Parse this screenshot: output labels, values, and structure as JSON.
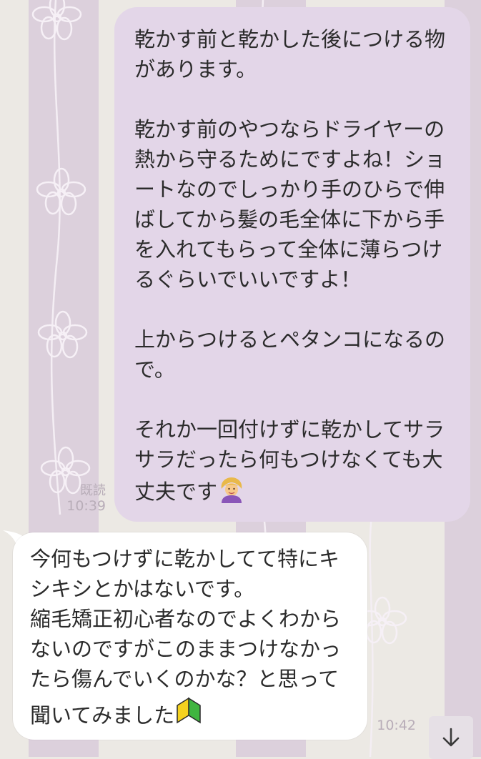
{
  "chat": {
    "outgoing": {
      "text_p1": "乾かす前と乾かした後につける物があります。\n\n乾かす前のやつならドライヤーの熱から守るためにですよね！ショートなのでしっかり手のひらで伸ばしてから髪の毛全体に下から手を入れてもらって全体に薄らつけるぐらいでいいですよ！\n\n上からつけるとペタンコになるので。\n\nそれか一回付けずに乾かしてサラサラだったら何もつけなくても大丈夫です",
      "emoji_icon": "woman-gesturing-ok-icon",
      "read_receipt": "既読",
      "time": "10:39"
    },
    "incoming": {
      "text_p1": "今何もつけずに乾かしてて特にキシキシとかはないです。\n縮毛矯正初心者なのでよくわからないのですがこのままつけなかったら傷んでいくのかな？と思って聞いてみました",
      "emoji_icon": "beginner-mark-icon",
      "time": "10:42"
    }
  },
  "colors": {
    "outgoing_bubble": "#e3d6e8",
    "incoming_bubble": "#ffffff",
    "wallpaper_stripe": "#dcd0dc",
    "wallpaper_base": "#ece9e4"
  },
  "controls": {
    "scroll_down_icon": "arrow-down-icon"
  }
}
